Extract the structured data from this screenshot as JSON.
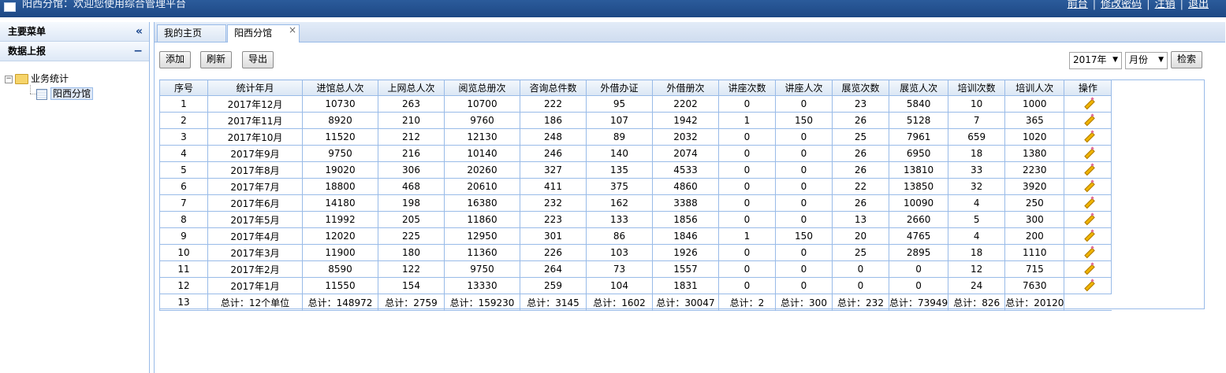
{
  "header": {
    "title": "阳西分馆：欢迎您使用综合管理平台",
    "links": [
      "前台",
      "修改密码",
      "注销",
      "退出"
    ],
    "separator": "|"
  },
  "sidebar": {
    "main_menu": "主要菜单",
    "main_menu_ctl": "«",
    "section": "数据上报",
    "section_ctl": "−",
    "tree": {
      "expand": "−",
      "root": "业务统计",
      "child": "阳西分馆"
    }
  },
  "tabs": [
    {
      "label": "我的主页"
    },
    {
      "label": "阳西分馆",
      "close": "×"
    }
  ],
  "toolbar": {
    "add": "添加",
    "refresh": "刷新",
    "export": "导出",
    "year": "2017年",
    "month": "月份",
    "search": "检索"
  },
  "table": {
    "columns": [
      "序号",
      "统计年月",
      "进馆总人次",
      "上网总人次",
      "阅览总册次",
      "咨询总件数",
      "外借办证",
      "外借册次",
      "讲座次数",
      "讲座人次",
      "展览次数",
      "展览人次",
      "培训次数",
      "培训人次",
      "操作"
    ],
    "rows": [
      [
        "1",
        "2017年12月",
        "10730",
        "263",
        "10700",
        "222",
        "95",
        "2202",
        "0",
        "0",
        "23",
        "5840",
        "10",
        "1000"
      ],
      [
        "2",
        "2017年11月",
        "8920",
        "210",
        "9760",
        "186",
        "107",
        "1942",
        "1",
        "150",
        "26",
        "5128",
        "7",
        "365"
      ],
      [
        "3",
        "2017年10月",
        "11520",
        "212",
        "12130",
        "248",
        "89",
        "2032",
        "0",
        "0",
        "25",
        "7961",
        "659",
        "1020"
      ],
      [
        "4",
        "2017年9月",
        "9750",
        "216",
        "10140",
        "246",
        "140",
        "2074",
        "0",
        "0",
        "26",
        "6950",
        "18",
        "1380"
      ],
      [
        "5",
        "2017年8月",
        "19020",
        "306",
        "20260",
        "327",
        "135",
        "4533",
        "0",
        "0",
        "26",
        "13810",
        "33",
        "2230"
      ],
      [
        "6",
        "2017年7月",
        "18800",
        "468",
        "20610",
        "411",
        "375",
        "4860",
        "0",
        "0",
        "22",
        "13850",
        "32",
        "3920"
      ],
      [
        "7",
        "2017年6月",
        "14180",
        "198",
        "16380",
        "232",
        "162",
        "3388",
        "0",
        "0",
        "26",
        "10090",
        "4",
        "250"
      ],
      [
        "8",
        "2017年5月",
        "11992",
        "205",
        "11860",
        "223",
        "133",
        "1856",
        "0",
        "0",
        "13",
        "2660",
        "5",
        "300"
      ],
      [
        "9",
        "2017年4月",
        "12020",
        "225",
        "12950",
        "301",
        "86",
        "1846",
        "1",
        "150",
        "20",
        "4765",
        "4",
        "200"
      ],
      [
        "10",
        "2017年3月",
        "11900",
        "180",
        "11360",
        "226",
        "103",
        "1926",
        "0",
        "0",
        "25",
        "2895",
        "18",
        "1110"
      ],
      [
        "11",
        "2017年2月",
        "8590",
        "122",
        "9750",
        "264",
        "73",
        "1557",
        "0",
        "0",
        "0",
        "0",
        "12",
        "715"
      ],
      [
        "12",
        "2017年1月",
        "11550",
        "154",
        "13330",
        "259",
        "104",
        "1831",
        "0",
        "0",
        "0",
        "0",
        "24",
        "7630"
      ]
    ],
    "total_row": [
      "13",
      "总计：12个单位",
      "总计：148972",
      "总计：2759",
      "总计：159230",
      "总计：3145",
      "总计：1602",
      "总计：30047",
      "总计：2",
      "总计：300",
      "总计：232",
      "总计：73949",
      "总计：826",
      "总计：20120"
    ],
    "edit_icon": "pencil-icon"
  }
}
